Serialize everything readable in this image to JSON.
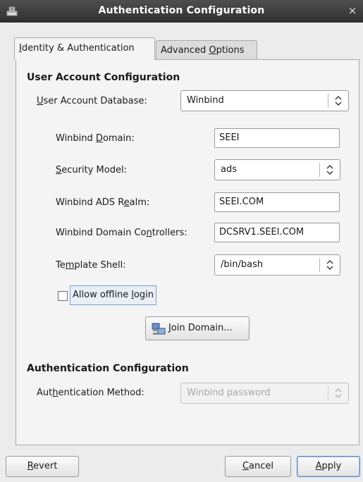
{
  "window": {
    "title": "Authentication Configuration",
    "close_glyph": "×",
    "app_icon": "system-config-icon"
  },
  "tabs": [
    {
      "pre": "",
      "key": "I",
      "post": "dentity & Authentication"
    },
    {
      "pre": "Advanced ",
      "key": "O",
      "post": "ptions"
    }
  ],
  "user_section": {
    "title": "User Account Configuration"
  },
  "user_db": {
    "pre": "",
    "key": "U",
    "post": "ser Account Database:",
    "value": "Winbind"
  },
  "winbind_domain": {
    "pre": "Winbind ",
    "key": "D",
    "post": "omain:",
    "value": "SEEI"
  },
  "security_model": {
    "pre": "",
    "key": "S",
    "post": "ecurity Model:",
    "value": "ads"
  },
  "ads_realm": {
    "pre": "Winbind ADS R",
    "key": "e",
    "post": "alm:",
    "value": "SEEI.COM"
  },
  "domain_controllers": {
    "pre": "Winbind Domain Co",
    "key": "n",
    "post": "trollers:",
    "value": "DCSRV1.SEEI.COM"
  },
  "template_shell": {
    "pre": "Te",
    "key": "m",
    "post": "plate Shell:",
    "value": "/bin/bash"
  },
  "offline_login": {
    "pre": "Allow offline ",
    "key": "l",
    "post": "ogin",
    "checked": false
  },
  "join_domain": {
    "pre": "",
    "key": "J",
    "post": "oin Domain..."
  },
  "auth_section": {
    "title": "Authentication Configuration"
  },
  "auth_method": {
    "pre": "Aut",
    "key": "h",
    "post": "entication Method:",
    "value": "Winbind password",
    "disabled": true
  },
  "buttons": {
    "revert": {
      "pre": "",
      "key": "R",
      "post": "evert"
    },
    "cancel": {
      "pre": "",
      "key": "C",
      "post": "ancel"
    },
    "apply": {
      "pre": "",
      "key": "A",
      "post": "pply"
    }
  }
}
